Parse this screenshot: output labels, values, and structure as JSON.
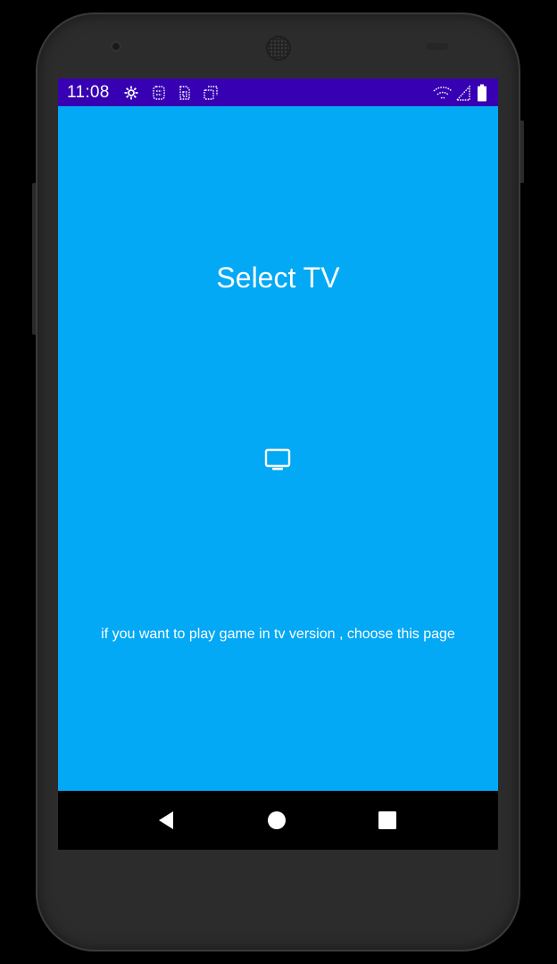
{
  "status_bar": {
    "time": "11:08",
    "background_color": "#3700b3",
    "notification_icons": [
      "settings-icon",
      "debug-icon",
      "sim-icon",
      "sync-icon"
    ],
    "right_icons": [
      "wifi-icon",
      "signal-icon",
      "battery-icon"
    ]
  },
  "main": {
    "background_color": "#03a9f4",
    "title": "Select TV",
    "icon": "tv-icon",
    "hint": "if you want to play game in tv version , choose this page"
  },
  "nav_bar": {
    "buttons": [
      "back-icon",
      "home-icon",
      "recents-icon"
    ]
  }
}
